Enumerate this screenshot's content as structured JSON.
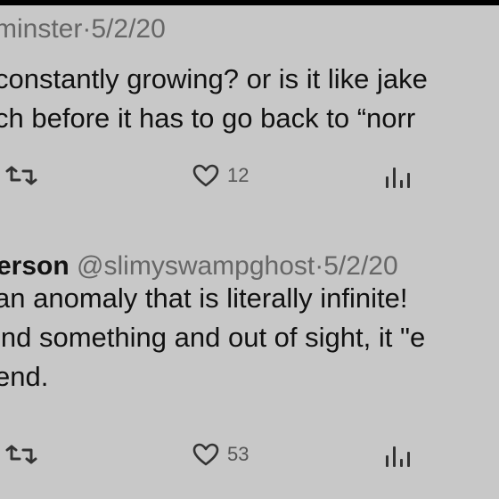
{
  "tweets": [
    {
      "header": {
        "handle_partial": "minster",
        "separator": "·",
        "date": "5/2/20"
      },
      "body_lines": [
        "constantly growing? or is it like jake",
        "ch before it has to go back to “norr"
      ],
      "actions": {
        "retweet_icon": "retweet-icon",
        "like_icon": "heart-icon",
        "like_count": "12",
        "views_icon": "views-icon"
      }
    },
    {
      "header": {
        "name_partial": "erson",
        "handle": "@slimyswampghost",
        "separator": "·",
        "date": "5/2/20"
      },
      "body_lines": [
        " an anomaly that is literally infinite!",
        "ind something and out of sight, it \"e",
        "end."
      ],
      "actions": {
        "retweet_icon": "retweet-icon",
        "like_icon": "heart-icon",
        "like_count": "53",
        "views_icon": "views-icon"
      }
    }
  ]
}
